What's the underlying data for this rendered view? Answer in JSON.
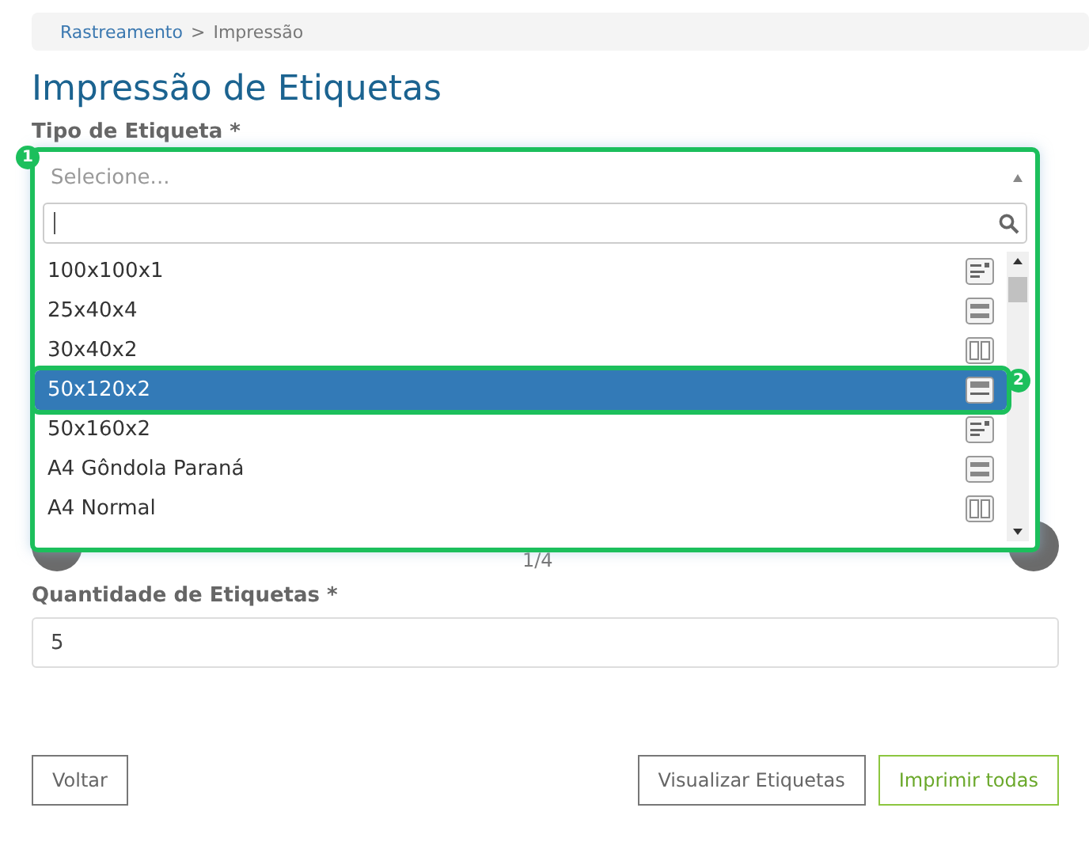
{
  "breadcrumb": {
    "link": "Rastreamento",
    "separator": ">",
    "current": "Impressão"
  },
  "title": "Impressão de Etiquetas",
  "label_type": {
    "label": "Tipo de Etiqueta *",
    "callout": "1",
    "placeholder": "Selecione...",
    "expanded": true,
    "options": [
      {
        "label": "100x100x1",
        "selected": false
      },
      {
        "label": "25x40x4",
        "selected": false
      },
      {
        "label": "30x40x2",
        "selected": false
      },
      {
        "label": "50x120x2",
        "selected": true,
        "callout": "2"
      },
      {
        "label": "50x160x2",
        "selected": false
      },
      {
        "label": "A4 Gôndola Paraná",
        "selected": false
      },
      {
        "label": "A4 Normal",
        "selected": false
      }
    ]
  },
  "carousel": {
    "pager": "1/4"
  },
  "quantity": {
    "label": "Quantidade de Etiquetas *",
    "value": "5"
  },
  "buttons": [
    {
      "label": "Voltar",
      "kind": "back"
    },
    {
      "label": "Visualizar Etiquetas",
      "kind": "secondary"
    },
    {
      "label": "Imprimir todas",
      "kind": "primary"
    }
  ]
}
